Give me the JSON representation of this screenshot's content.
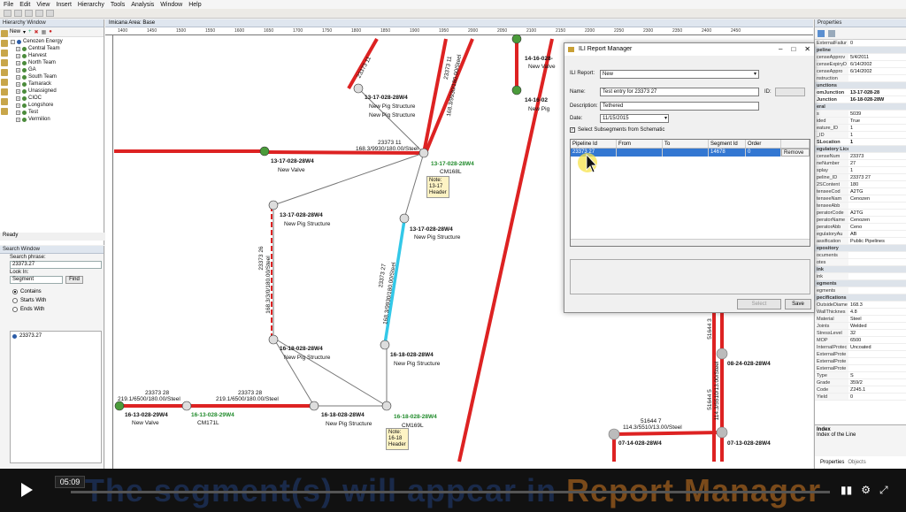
{
  "menu": [
    "File",
    "Edit",
    "View",
    "Insert",
    "Hierarchy",
    "Tools",
    "Analysis",
    "Window",
    "Help"
  ],
  "hierarchy": {
    "title": "Hierarchy Window",
    "new_label": "New",
    "root": "Cenozen Energy",
    "items": [
      "Central Team",
      "Harvest",
      "North Team",
      "GA",
      "South Team",
      "Tamarack",
      "Unassigned",
      "CIOC",
      "Longshore",
      "Test",
      "Vermilion"
    ],
    "status": "Ready"
  },
  "search": {
    "title": "Search Window",
    "phrase_label": "Search phrase:",
    "phrase_value": "23373.27",
    "look_in_label": "Look In:",
    "look_in_value": "Segment",
    "find_label": "Find",
    "options": [
      "Contains",
      "Starts With",
      "Ends With"
    ],
    "selected_option": "Contains",
    "result": "23373.27"
  },
  "canvas": {
    "title": "Imicana Area: Base",
    "ruler_ticks": [
      "1400",
      "1450",
      "1500",
      "1550",
      "1600",
      "1650",
      "1700",
      "1750",
      "1800",
      "1850",
      "1900",
      "1950",
      "2000",
      "2050",
      "2100",
      "2150",
      "2200",
      "2250",
      "2300",
      "2350",
      "2400",
      "2450"
    ],
    "labels": {
      "n1": "13-17-028-28W4",
      "n1a": "New Pig Structure",
      "n1b": "New Pig Structure",
      "n2": "14-16-028-",
      "n2a": "New Valve",
      "n3": "14-16-02",
      "n3a": "New Pig",
      "valve_w": "13-17-028-28W4",
      "valve_w_a": "New Valve",
      "cm168": "13-17-028-28W4",
      "cm168_a": "CM168L",
      "seg_top": "23373 11",
      "seg_top_b": "168.3/9930/180.00/Steel",
      "n4": "13-17-028-28W4",
      "n4a": "New Pig Structure",
      "n5": "13-17-028-28W4",
      "n5a": "New Pig Structure",
      "vert1": "23373 26",
      "vert1b": "168.3/3/0/180.00/Steel",
      "vert2": "23373 27",
      "vert2b": "168.3/9930/180.00/Steel",
      "n6": "16-18-028-28W4",
      "n6a": "New Pig Structure",
      "n7": "16-18-028-28W4",
      "n7a": "New Pig Structure",
      "n8": "16-18-028-28W4",
      "n8a": "New Pig Structure",
      "cm169": "16-18-028-28W4",
      "cm169_a": "CM169L",
      "n9": "16-13-028-29W4",
      "n9a": "New Valve",
      "cm171": "16-13-028-29W4",
      "cm171_a": "CM171L",
      "seg_b1": "23373 28",
      "seg_b1b": "219.1/6500/180.00/Steel",
      "seg_b2": "23373 28",
      "seg_b2b": "219.1/6500/180.00/Steel",
      "seg_r": "51644 7",
      "seg_rb": "114.3/5510/13.00/Steel",
      "n10": "08-24-028-28W4",
      "n11": "07-14-028-28W4",
      "n12": "07-13-028-28W4",
      "vert_r": "51644 5",
      "vert_rb": "114.3/5510/13.00/Steel",
      "vert_rr": "51644 3",
      "seg_top2": "23373 11",
      "seg_top2b": "168.3/9930/180.00/Steel",
      "seg_top3": "23373 11",
      "seg_top3b": "168.3/9930/180.00/Steel"
    },
    "notes": [
      {
        "line1": "Note:",
        "line2": "13-17",
        "line3": "Header"
      },
      {
        "line1": "Note:",
        "line2": "16-18",
        "line3": "Header"
      }
    ]
  },
  "dialog": {
    "title": "ILI Report Manager",
    "ili_report_label": "ILI Report:",
    "ili_report_value": "New",
    "name_label": "Name:",
    "name_value": "Test entry for 23373 27",
    "id_label": "ID:",
    "description_label": "Description:",
    "description_value": "Tethered",
    "date_label": "Date:",
    "date_value": "11/15/2015",
    "checkbox_label": "Select Subsegments from Schematic",
    "columns": [
      "Pipeline Id",
      "From",
      "To",
      "Segment Id",
      "Order"
    ],
    "row": {
      "pipeline_id": "23373 27",
      "from": "",
      "to": "",
      "segment_id": "14678",
      "order": "0",
      "action": "Remove"
    },
    "select_label": "Select",
    "save_label": "Save"
  },
  "properties": {
    "title": "Properties",
    "rows": [
      {
        "k": "ExternalFailur",
        "v": "0",
        "type": ""
      },
      {
        "k": "peline",
        "v": "",
        "type": "sec"
      },
      {
        "k": "censeApprov",
        "v": "5/4/2011",
        "type": ""
      },
      {
        "k": "censeExpiryD",
        "v": "6/14/2002",
        "type": ""
      },
      {
        "k": "censeAppro",
        "v": "6/14/2002",
        "type": ""
      },
      {
        "k": "nstruction",
        "v": "",
        "type": ""
      },
      {
        "k": "unctions",
        "v": "",
        "type": "sec"
      },
      {
        "k": "omJunction",
        "v": "13-17-028-28",
        "type": "sel"
      },
      {
        "k": "Junction",
        "v": "16-18-028-28W",
        "type": "sel"
      },
      {
        "k": "eral",
        "v": "",
        "type": "sec"
      },
      {
        "k": "s",
        "v": "5039",
        "type": ""
      },
      {
        "k": "ided",
        "v": "True",
        "type": ""
      },
      {
        "k": "eature_ID",
        "v": "1",
        "type": ""
      },
      {
        "k": "_ID",
        "v": "1",
        "type": ""
      },
      {
        "k": "SLocation",
        "v": "1",
        "type": "sel"
      },
      {
        "k": "egulatory License",
        "v": "",
        "type": "sec"
      },
      {
        "k": "censeNum",
        "v": "23373",
        "type": ""
      },
      {
        "k": "neNumber",
        "v": "27",
        "type": ""
      },
      {
        "k": "splay",
        "v": "1",
        "type": ""
      },
      {
        "k": "peline_ID",
        "v": "23373 27",
        "type": ""
      },
      {
        "k": "2SContent",
        "v": "180",
        "type": ""
      },
      {
        "k": "tenseeCod",
        "v": "A2TG",
        "type": ""
      },
      {
        "k": "tenseeNam",
        "v": "Cenozen",
        "type": ""
      },
      {
        "k": "tenseeAbb",
        "v": "",
        "type": ""
      },
      {
        "k": "peratorCode",
        "v": "A2TG",
        "type": ""
      },
      {
        "k": "peratorName",
        "v": "Cenozen",
        "type": ""
      },
      {
        "k": "peratorAbb",
        "v": "Ceno",
        "type": ""
      },
      {
        "k": "egulatoryAu",
        "v": "AB",
        "type": ""
      },
      {
        "k": "assification",
        "v": "Public Pipelines",
        "type": ""
      },
      {
        "k": "epository",
        "v": "",
        "type": "sec"
      },
      {
        "k": "ocuments",
        "v": "",
        "type": ""
      },
      {
        "k": "otes",
        "v": "",
        "type": ""
      },
      {
        "k": "ink",
        "v": "",
        "type": "sec"
      },
      {
        "k": "ink",
        "v": "",
        "type": ""
      },
      {
        "k": "egments",
        "v": "",
        "type": "sec"
      },
      {
        "k": "egments",
        "v": "",
        "type": ""
      },
      {
        "k": "pecifications",
        "v": "",
        "type": "sec"
      },
      {
        "k": "OutsideDiame",
        "v": "168.3",
        "type": ""
      },
      {
        "k": "WallThicknes",
        "v": "4.8",
        "type": ""
      },
      {
        "k": "Material",
        "v": "Steel",
        "type": ""
      },
      {
        "k": "Joints",
        "v": "Welded",
        "type": ""
      },
      {
        "k": "StressLevel",
        "v": "32",
        "type": ""
      },
      {
        "k": "MOP",
        "v": "6500",
        "type": ""
      },
      {
        "k": "InternalProtec",
        "v": "Uncoated",
        "type": ""
      },
      {
        "k": "ExternalProte",
        "v": "",
        "type": ""
      },
      {
        "k": "ExternalProte",
        "v": "",
        "type": ""
      },
      {
        "k": "ExternalProte",
        "v": "",
        "type": ""
      },
      {
        "k": "Type",
        "v": "S",
        "type": ""
      },
      {
        "k": "Grade",
        "v": "359/2",
        "type": ""
      },
      {
        "k": "Code",
        "v": "Z245.1",
        "type": ""
      },
      {
        "k": "Yield",
        "v": "0",
        "type": ""
      }
    ],
    "footer_title": "Index",
    "footer_desc": "Index of the Line",
    "tabs": [
      "Properties",
      "Objects"
    ]
  },
  "player": {
    "time": "05:09",
    "progress": 0.0,
    "caption_a": "The segment(s) will appear in ",
    "caption_b": "Report Manager"
  },
  "colors": {
    "pipe": "#dd2222",
    "selected": "#33c8e8",
    "accent": "#3377d2"
  }
}
